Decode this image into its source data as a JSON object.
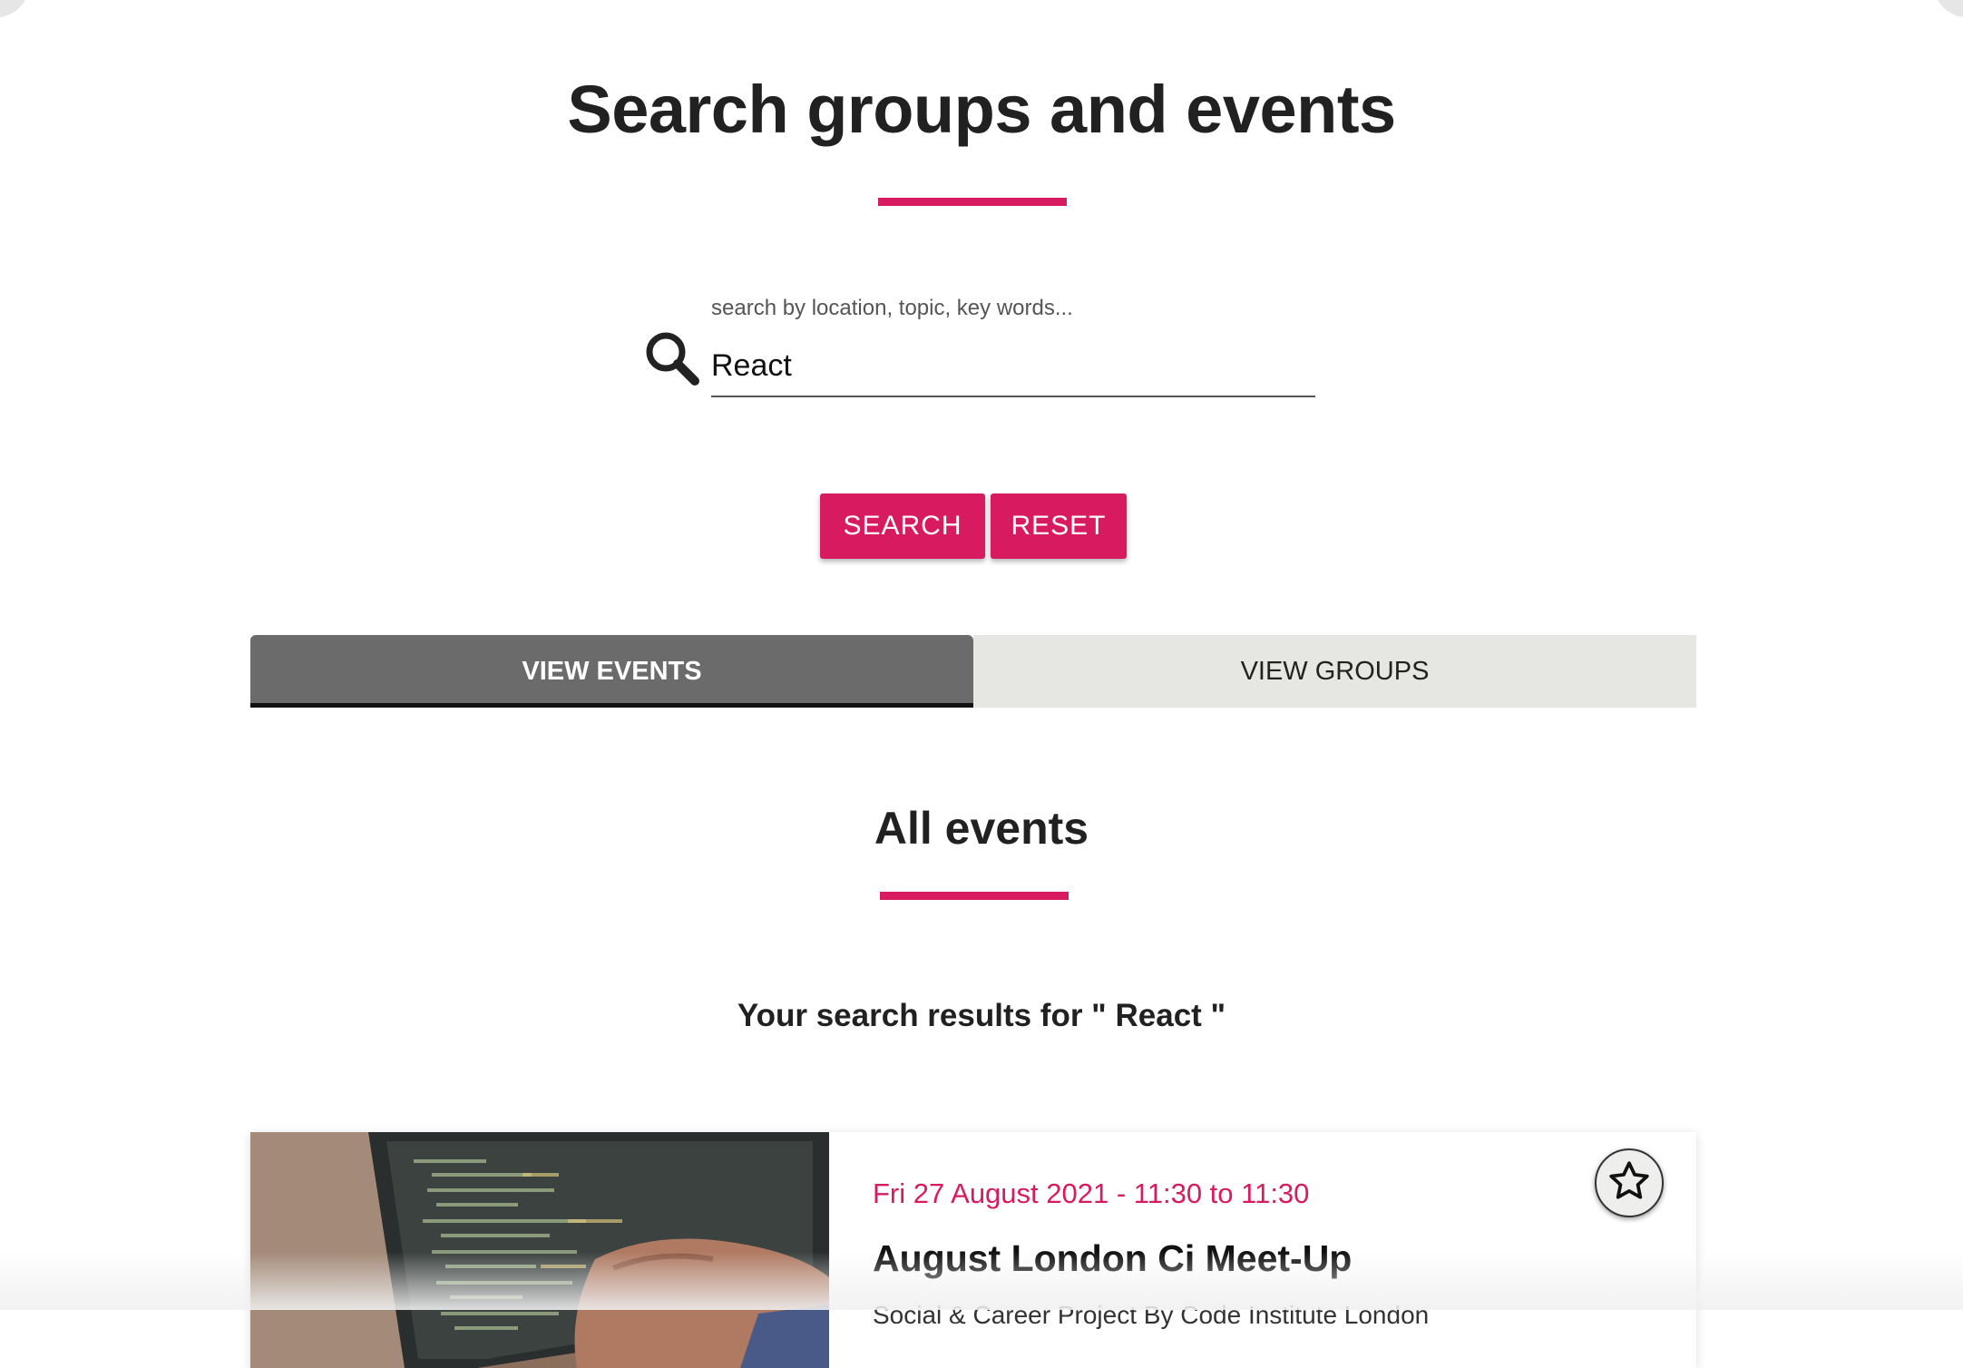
{
  "page": {
    "title": "Search groups and events",
    "accent_color": "#d81b60"
  },
  "search": {
    "hint": "search by location, topic, key words...",
    "value": "React",
    "icon": "search-icon"
  },
  "buttons": {
    "search_label": "SEARCH",
    "reset_label": "RESET"
  },
  "tabs": [
    {
      "label": "VIEW EVENTS",
      "active": true
    },
    {
      "label": "VIEW GROUPS",
      "active": false
    }
  ],
  "events": {
    "section_title": "All events",
    "results_text": "Your search results for \" React \"",
    "items": [
      {
        "date": "Fri 27 August 2021 - 11:30 to 11:30",
        "title": "August London Ci Meet-Up",
        "subtitle": "Social & Career Project By Code Institute London",
        "favorite_icon": "star-outline-icon"
      }
    ]
  }
}
